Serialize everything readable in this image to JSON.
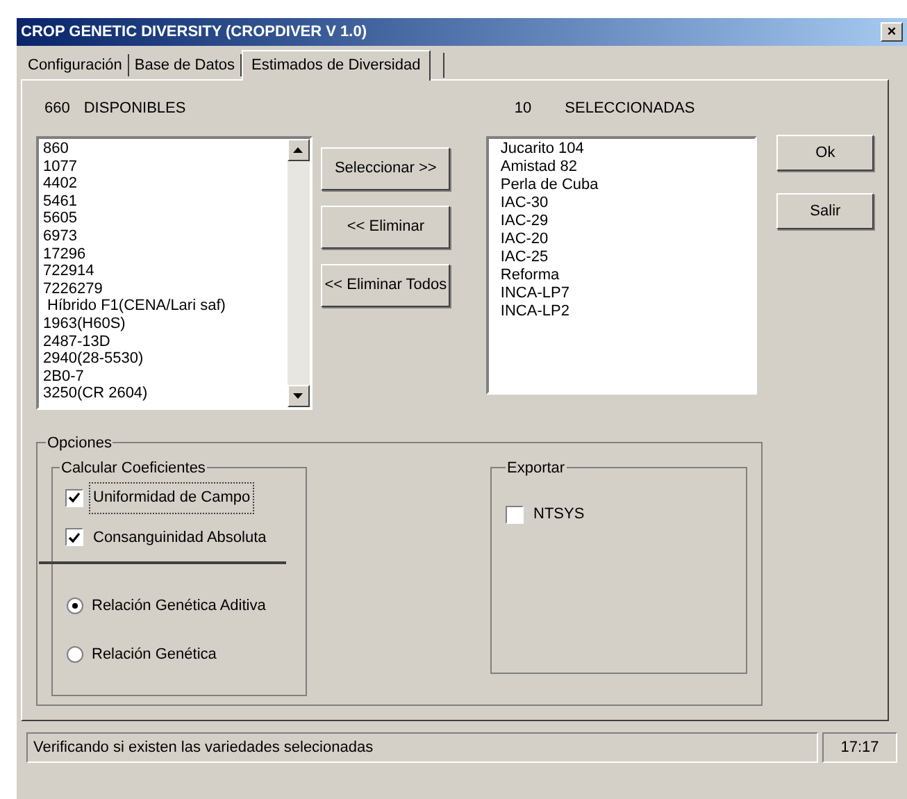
{
  "window": {
    "title": "CROP GENETIC DIVERSITY (CROPDIVER V 1.0)",
    "close": "×"
  },
  "tabs": [
    {
      "label": "Configuración",
      "selected": false
    },
    {
      "label": "Base de Datos",
      "selected": false
    },
    {
      "label": "Estimados de Diversidad",
      "selected": true
    }
  ],
  "available": {
    "count": "660",
    "label": "DISPONIBLES",
    "items": [
      "860",
      "1077",
      "4402",
      "5461",
      "5605",
      "6973",
      "17296",
      "722914",
      "7226279",
      " Híbrido F1(CENA/Lari saf)",
      "1963(H60S)",
      "2487-13D",
      "2940(28-5530)",
      "2B0-7",
      "3250(CR 2604)"
    ]
  },
  "actions": [
    "Seleccionar >>",
    "<< Eliminar",
    "<< Eliminar Todos"
  ],
  "selected_list": {
    "count": "10",
    "label": "SELECCIONADAS",
    "items": [
      "Jucarito 104",
      "Amistad 82",
      "Perla de Cuba",
      "IAC-30",
      "IAC-29",
      "IAC-20",
      "IAC-25",
      "Reforma",
      "INCA-LP7",
      "INCA-LP2"
    ]
  },
  "dialog_buttons": [
    "Ok",
    "Salir"
  ],
  "options": {
    "title": "Opciones",
    "coefficients": {
      "title": "Calcular Coeficientes",
      "checks": [
        {
          "label": "Uniformidad de Campo",
          "checked": true,
          "focused": true
        },
        {
          "label": "Consanguinidad Absoluta",
          "checked": true,
          "focused": false
        }
      ],
      "radios": [
        {
          "label": "Relación Genética Aditiva",
          "selected": true
        },
        {
          "label": "Relación Genética",
          "selected": false
        }
      ]
    },
    "export": {
      "title": "Exportar",
      "checks": [
        {
          "label": "NTSYS",
          "checked": false
        }
      ]
    }
  },
  "status_bar": {
    "message": "Verificando si existen las variedades selecionadas",
    "time": "17:17"
  }
}
